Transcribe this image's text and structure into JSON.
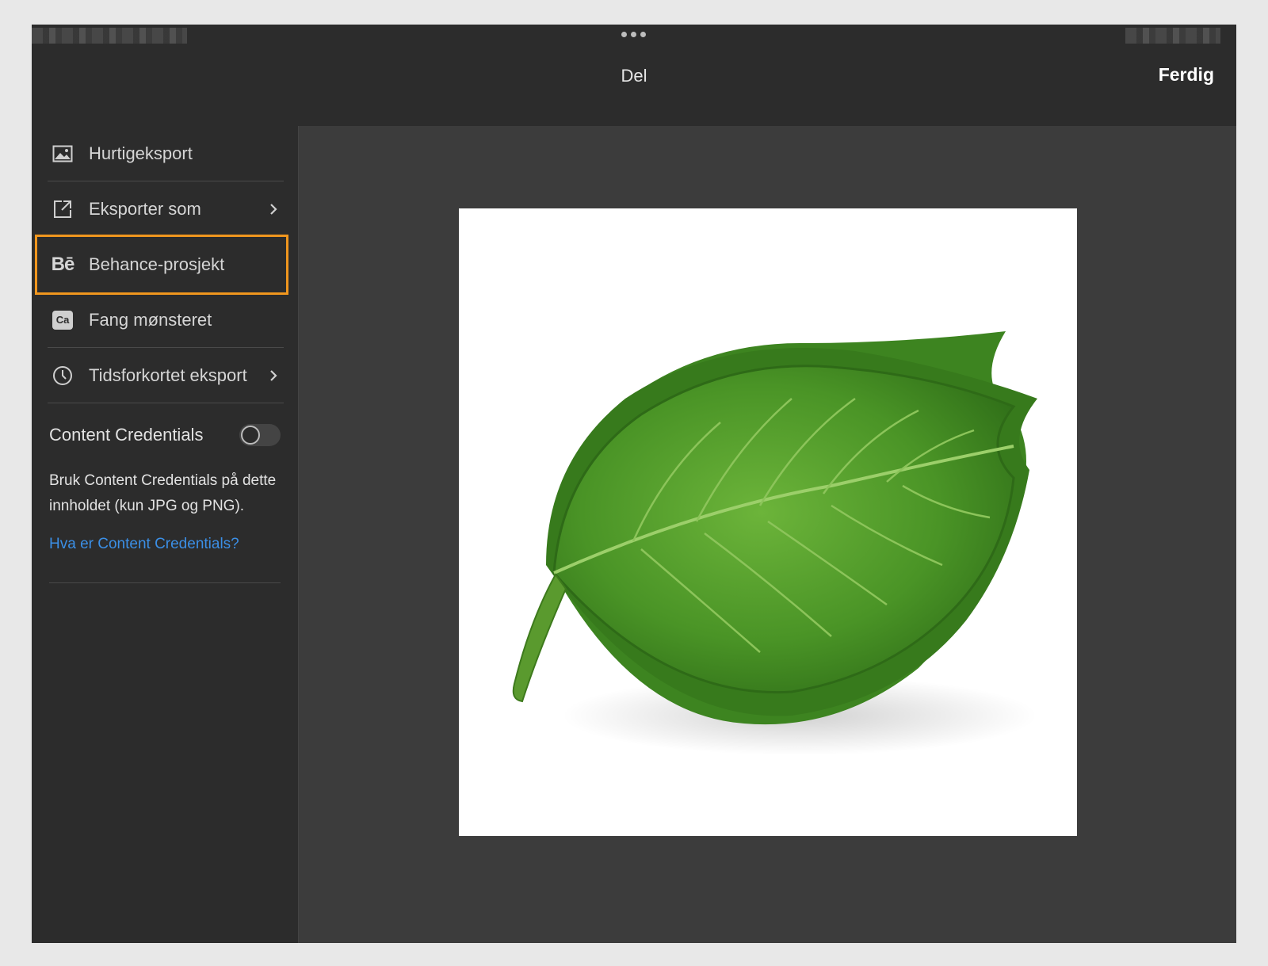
{
  "header": {
    "title": "Del",
    "done_label": "Ferdig"
  },
  "menu": {
    "items": [
      {
        "label": "Hurtigeksport",
        "icon": "image-icon"
      },
      {
        "label": "Eksporter som",
        "icon": "export-icon"
      },
      {
        "label": "Behance-prosjekt",
        "icon": "behance-icon",
        "icon_text": "Bē"
      },
      {
        "label": "Fang mønsteret",
        "icon": "capture-icon",
        "icon_text": "Ca"
      },
      {
        "label": "Tidsforkortet eksport",
        "icon": "clock-icon"
      }
    ]
  },
  "content_credentials": {
    "label": "Content Credentials",
    "enabled": false,
    "description": "Bruk Content Credentials på dette innholdet (kun JPG og PNG).",
    "link": "Hva er Content Credentials?"
  },
  "colors": {
    "highlight": "#f0961e",
    "link": "#3b8fe6",
    "leaf": "#4e9a2a"
  }
}
